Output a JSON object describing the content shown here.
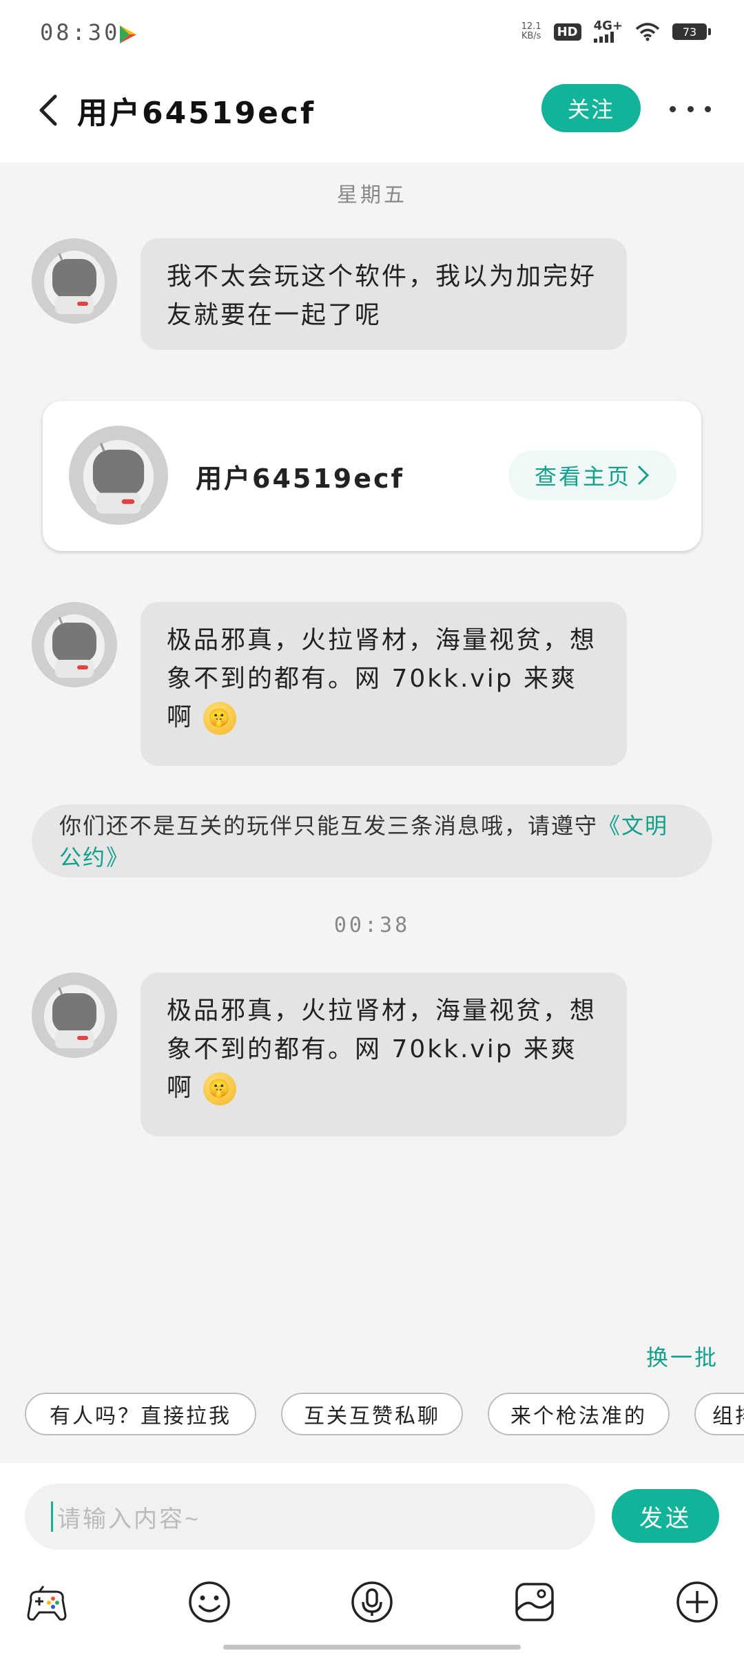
{
  "status_bar": {
    "time": "08:30",
    "net_speed_value": "12.1",
    "net_speed_unit": "KB/s",
    "hd": "HD",
    "network": "4G+",
    "battery": "73"
  },
  "header": {
    "title": "用户64519ecf",
    "follow_label": "关注"
  },
  "chat": {
    "date_1": "星期五",
    "msg_1": "我不太会玩这个软件，我以为加完好友就要在一起了呢",
    "card_name": "用户64519ecf",
    "card_link": "查看主页",
    "msg_2_text": "极品邪真，火拉肾材，海量视贫，想象不到的都有。网 70kk.vip 来爽啊",
    "msg_2_emoji": "🤫",
    "notice_text": "你们还不是互关的玩伴只能互发三条消息哦，请遵守",
    "notice_link": "《文明公约》",
    "time_2": "00:38",
    "msg_3_text": "极品邪真，火拉肾材，海量视贫，想象不到的都有。网 70kk.vip 来爽啊",
    "msg_3_emoji": "🤫"
  },
  "quick_replies": {
    "swap_label": "换一批",
    "items": [
      "有人吗？直接拉我",
      "互关互赞私聊",
      "来个枪法准的",
      "组排"
    ]
  },
  "input": {
    "placeholder": "请输入内容~",
    "send_label": "发送"
  },
  "toolbar": {
    "icons": [
      "gamepad-icon",
      "emoji-icon",
      "microphone-icon",
      "image-icon",
      "plus-icon"
    ]
  },
  "colors": {
    "accent": "#13b39a",
    "bubble": "#e4e4e4",
    "background": "#f4f4f4"
  }
}
